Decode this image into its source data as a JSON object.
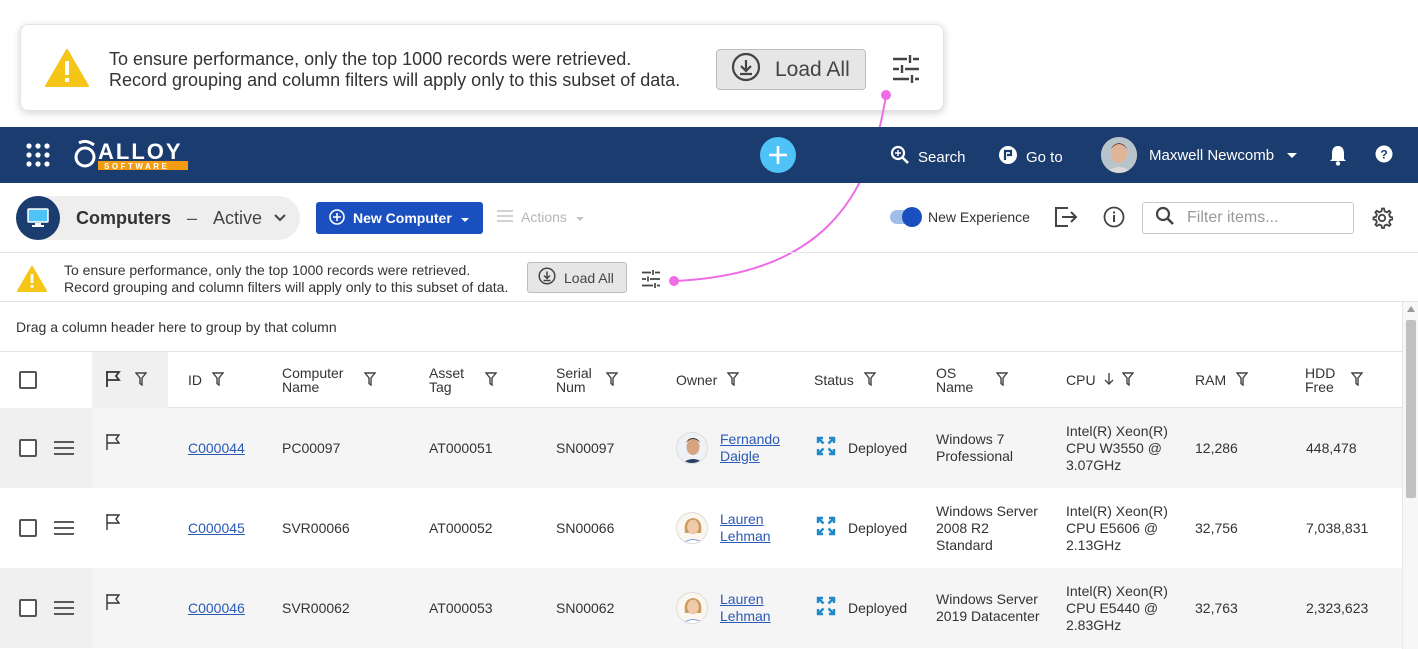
{
  "callout": {
    "line1": "To ensure performance, only the top 1000 records were retrieved.",
    "line2": "Record grouping and column filters will apply only to this subset of data.",
    "load_all": "Load All"
  },
  "navbar": {
    "logo_text": "ALLOY",
    "logo_sub": "SOFTWARE",
    "search": "Search",
    "goto": "Go to",
    "user_name": "Maxwell Newcomb"
  },
  "toolbar": {
    "title": "Computers",
    "separator": "–",
    "view": "Active",
    "new_button": "New Computer",
    "actions": "Actions",
    "new_experience": "New Experience",
    "filter_placeholder": "Filter items..."
  },
  "notice": {
    "line1": "To ensure performance, only the top 1000 records were retrieved.",
    "line2": "Record grouping and column filters will apply only to this subset of data.",
    "load_all": "Load All"
  },
  "grid": {
    "group_hint": "Drag a column header here to group by that column",
    "columns": {
      "id": "ID",
      "computer_name": "Computer Name",
      "asset_tag": "Asset Tag",
      "serial_num": "Serial Num",
      "owner": "Owner",
      "status": "Status",
      "os_name": "OS Name",
      "cpu": "CPU",
      "ram": "RAM",
      "hdd_free": "HDD Free"
    },
    "rows": [
      {
        "id": "C000044",
        "computer_name": "PC00097",
        "asset_tag": "AT000051",
        "serial_num": "SN00097",
        "owner": "Fernando Daigle",
        "status": "Deployed",
        "os_name": "Windows 7 Professional",
        "cpu": "Intel(R) Xeon(R) CPU W3550 @ 3.07GHz",
        "ram": "12,286",
        "hdd_free": "448,478"
      },
      {
        "id": "C000045",
        "computer_name": "SVR00066",
        "asset_tag": "AT000052",
        "serial_num": "SN00066",
        "owner": "Lauren Lehman",
        "status": "Deployed",
        "os_name": "Windows Server 2008 R2 Standard",
        "cpu": "Intel(R) Xeon(R) CPU E5606 @ 2.13GHz",
        "ram": "32,756",
        "hdd_free": "7,038,831"
      },
      {
        "id": "C000046",
        "computer_name": "SVR00062",
        "asset_tag": "AT000053",
        "serial_num": "SN00062",
        "owner": "Lauren Lehman",
        "status": "Deployed",
        "os_name": "Windows Server 2019 Datacenter",
        "cpu": "Intel(R) Xeon(R) CPU E5440 @ 2.83GHz",
        "ram": "32,763",
        "hdd_free": "2,323,623"
      }
    ]
  },
  "colors": {
    "navbar": "#1b3c6e",
    "primary": "#1a4fbf",
    "accent_plus": "#4fc3f7",
    "warning": "#f5c518",
    "connector": "#ee6de6",
    "link": "#2a5ab4"
  }
}
